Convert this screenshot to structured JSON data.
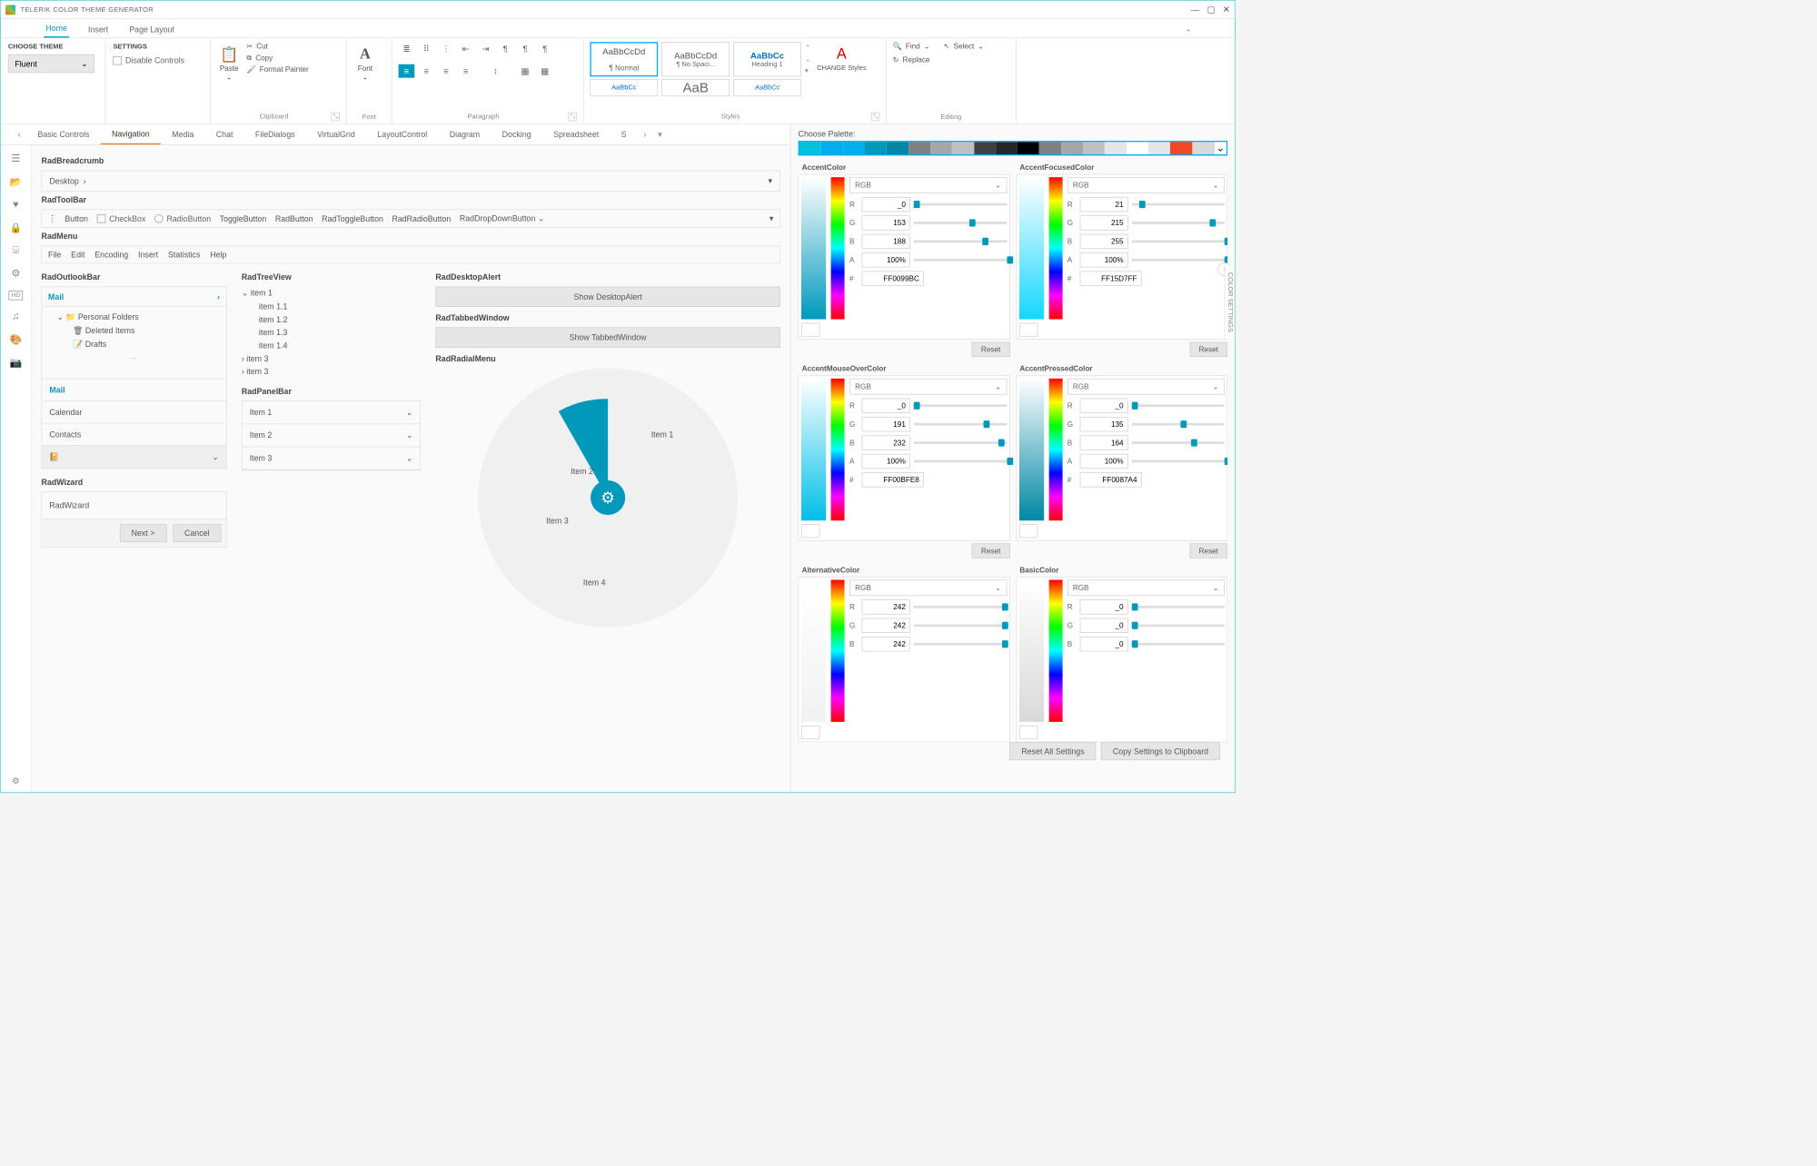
{
  "window": {
    "title": "TELERIK COLOR THEME GENERATOR"
  },
  "ribbonTabs": [
    "Home",
    "Insert",
    "Page Layout"
  ],
  "activeRibbonTab": 0,
  "chooseTheme": {
    "header": "CHOOSE THEME",
    "value": "Fluent"
  },
  "settings": {
    "header": "SETTINGS",
    "disableLabel": "Disable Controls"
  },
  "clipboard": {
    "label": "Clipboard",
    "paste": "Paste",
    "cut": "Cut",
    "copy": "Copy",
    "format": "Format Painter"
  },
  "font": {
    "label": "Font",
    "btn": "Font"
  },
  "paragraph": {
    "label": "Paragraph"
  },
  "stylesGroup": {
    "label": "Styles",
    "items": [
      {
        "text": "AaBbCcDd",
        "name": "¶ Normal",
        "selected": true
      },
      {
        "text": "AaBbCcDd",
        "name": "¶ No Spaci..."
      },
      {
        "text": "AaBbCc",
        "name": "Heading 1",
        "blue": true
      }
    ],
    "row2": [
      {
        "text": "AaBbCc"
      },
      {
        "text": "AaB"
      },
      {
        "text": "AaBbCc"
      }
    ],
    "changeStyles": "CHANGE Styles"
  },
  "editing": {
    "label": "Editing",
    "find": "Find",
    "select": "Select",
    "replace": "Replace"
  },
  "previewTabs": [
    "Basic Controls",
    "Navigation",
    "Media",
    "Chat",
    "FileDialogs",
    "VirtualGrid",
    "LayoutControl",
    "Diagram",
    "Docking",
    "Spreadsheet",
    "S"
  ],
  "activePreviewTab": 1,
  "sections": {
    "breadcrumb": {
      "title": "RadBreadcrumb",
      "value": "Desktop"
    },
    "toolbar": {
      "title": "RadToolBar",
      "button": "Button",
      "checkbox": "CheckBox",
      "radio": "RadioButton",
      "toggle": "ToggleButton",
      "rad": "RadButton",
      "radt": "RadToggleButton",
      "radr": "RadRadioButton",
      "radd": "RadDropDownButton"
    },
    "menu": {
      "title": "RadMenu",
      "items": [
        "File",
        "Edit",
        "Encoding",
        "Insert",
        "Statistics",
        "Help"
      ]
    },
    "outlook": {
      "title": "RadOutlookBar",
      "header": "Mail",
      "folders": [
        "Personal Folders",
        "Deleted Items",
        "Drafts"
      ],
      "sections": [
        "Mail",
        "Calendar",
        "Contacts"
      ]
    },
    "wizard": {
      "title": "RadWizard",
      "body": "RadWizard",
      "next": "Next >",
      "cancel": "Cancel"
    },
    "treeview": {
      "title": "RadTreeView",
      "i1": "item 1",
      "children": [
        "item 1.1",
        "item 1.2",
        "item 1.3",
        "item 1.4"
      ],
      "i3a": "item 3",
      "i3b": "item 3"
    },
    "panelbar": {
      "title": "RadPanelBar",
      "items": [
        "Item 1",
        "Item 2",
        "Item 3"
      ]
    },
    "alert": {
      "title": "RadDesktopAlert",
      "btn": "Show DesktopAlert"
    },
    "tabbed": {
      "title": "RadTabbedWindow",
      "btn": "Show TabbedWindow"
    },
    "radial": {
      "title": "RadRadialMenu",
      "items": [
        "Item 1",
        "Item 2",
        "Item 3",
        "Item 4"
      ]
    }
  },
  "colorPanel": {
    "choosePalette": "Choose Palette:",
    "palette": [
      "#00c2de",
      "#00aeef",
      "#00aeef",
      "#0099bc",
      "#0087a4",
      "#808080",
      "#a6a6a6",
      "#c0c0c0",
      "#404040",
      "#262626",
      "#000000",
      "#808080",
      "#a6a6a6",
      "#c0c0c0",
      "#e6e6e6",
      "#ffffff",
      "#e6e6e6",
      "#f24726",
      "#d9d9d9"
    ],
    "cards": [
      {
        "title": "AccentColor",
        "mode": "RGB",
        "c": "#0099bc",
        "r": "_0",
        "g": "153",
        "b": "188",
        "a": "100%",
        "hex": "FF0099BC",
        "sR": 0,
        "sG": 60,
        "sB": 74
      },
      {
        "title": "AccentFocusedColor",
        "mode": "RGB",
        "c": "#15d7ff",
        "r": "21",
        "g": "215",
        "b": "255",
        "a": "100%",
        "hex": "FF15D7FF",
        "sR": 8,
        "sG": 84,
        "sB": 100
      },
      {
        "title": "AccentMouseOverColor",
        "mode": "RGB",
        "c": "#00bfe8",
        "r": "_0",
        "g": "191",
        "b": "232",
        "a": "100%",
        "hex": "FF00BFE8",
        "sR": 0,
        "sG": 75,
        "sB": 91
      },
      {
        "title": "AccentPressedColor",
        "mode": "RGB",
        "c": "#0087a4",
        "r": "_0",
        "g": "135",
        "b": "164",
        "a": "100%",
        "hex": "FF0087A4",
        "sR": 0,
        "sG": 53,
        "sB": 64
      },
      {
        "title": "AlternativeColor",
        "mode": "RGB",
        "c": "#f2f2f2",
        "r": "242",
        "g": "242",
        "b": "242",
        "hex": "",
        "sR": 95,
        "sG": 95,
        "sB": 95,
        "short": true
      },
      {
        "title": "BasicColor",
        "mode": "RGB",
        "c": "#d9d9d9",
        "r": "_0",
        "g": "_0",
        "b": "_0",
        "hex": "",
        "sR": 0,
        "sG": 0,
        "sB": 0,
        "short": true
      }
    ],
    "reset": "Reset",
    "resetAll": "Reset All Settings",
    "copy": "Copy Settings to Clipboard"
  },
  "verticalTab": "COLOR SETTINGS"
}
